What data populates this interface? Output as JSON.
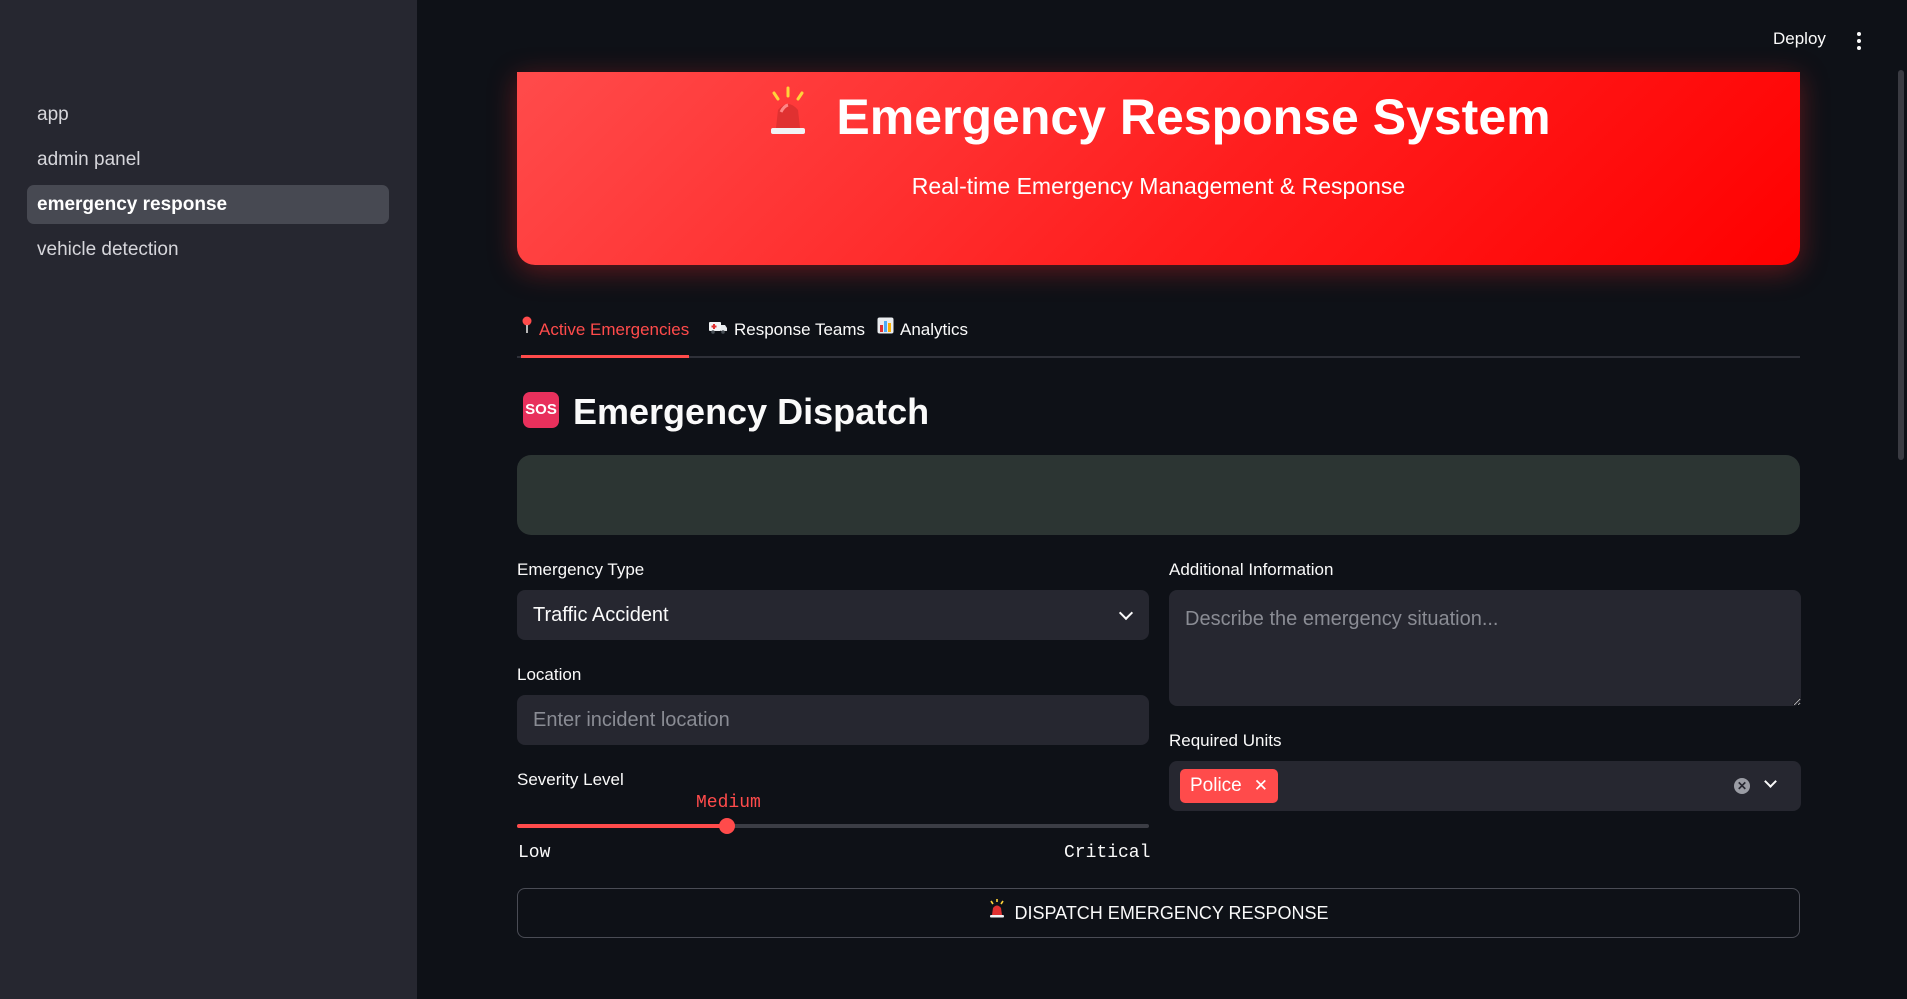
{
  "sidebar": {
    "items": [
      {
        "label": "app"
      },
      {
        "label": "admin panel"
      },
      {
        "label": "emergency response",
        "active": true
      },
      {
        "label": "vehicle detection"
      }
    ]
  },
  "header": {
    "deploy_label": "Deploy",
    "menu_icon": "kebab-menu-icon"
  },
  "hero": {
    "icon": "siren-icon",
    "title": "Emergency Response System",
    "subtitle": "Real-time Emergency Management & Response"
  },
  "tabs": [
    {
      "icon": "pin-icon",
      "label": "Active Emergencies",
      "active": true
    },
    {
      "icon": "ambulance-icon",
      "label": "Response Teams"
    },
    {
      "icon": "bar-chart-icon",
      "label": "Analytics"
    }
  ],
  "section": {
    "icon": "sos-icon",
    "icon_text": "SOS",
    "title": "Emergency Dispatch"
  },
  "form": {
    "emergency_type": {
      "label": "Emergency Type",
      "value": "Traffic Accident"
    },
    "location": {
      "label": "Location",
      "placeholder": "Enter incident location"
    },
    "severity": {
      "label": "Severity Level",
      "value": "Medium",
      "min": "Low",
      "max": "Critical",
      "fraction": 0.333
    },
    "additional_info": {
      "label": "Additional Information",
      "placeholder": "Describe the emergency situation..."
    },
    "required_units": {
      "label": "Required Units",
      "selected": [
        "Police"
      ]
    },
    "dispatch_label": "DISPATCH EMERGENCY RESPONSE"
  },
  "colors": {
    "accent": "#ff4b4b",
    "background": "#0e1117",
    "sidebar": "#262730",
    "hero_gradient_start": "#ff4b4b",
    "hero_gradient_end": "#ff0000"
  }
}
